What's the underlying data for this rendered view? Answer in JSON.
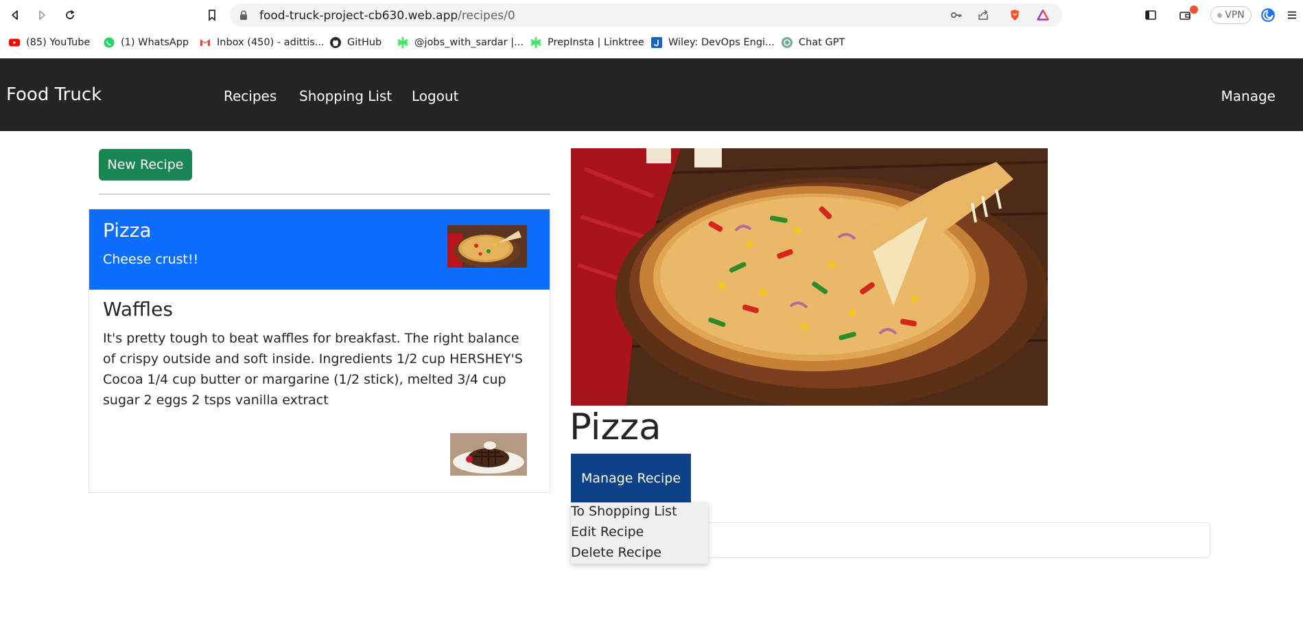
{
  "browser": {
    "url_host": "food-truck-project-cb630.web.app",
    "url_path": "/recipes/0",
    "vpn_label": "VPN",
    "bookmarks": [
      {
        "label": "(85) YouTube",
        "icon": "youtube-icon",
        "color": "#ff0000"
      },
      {
        "label": "(1) WhatsApp",
        "icon": "whatsapp-icon",
        "color": "#25d366"
      },
      {
        "label": "Inbox (450) - adittis...",
        "icon": "gmail-icon",
        "color": "#ea4335"
      },
      {
        "label": "GitHub",
        "icon": "github-icon",
        "color": "#24292e"
      },
      {
        "label": "@jobs_with_sardar |...",
        "icon": "linktree-icon",
        "color": "#43e660"
      },
      {
        "label": "PrepInsta | Linktree",
        "icon": "linktree-icon",
        "color": "#43e660"
      },
      {
        "label": "Wiley: DevOps Engi...",
        "icon": "wiley-j-icon",
        "color": "#1565c0"
      },
      {
        "label": "Chat GPT",
        "icon": "chatgpt-icon",
        "color": "#74aa9c"
      }
    ]
  },
  "navbar": {
    "brand": "Food Truck",
    "links": [
      "Recipes",
      "Shopping List",
      "Logout"
    ],
    "manage": "Manage"
  },
  "recipes": {
    "new_button": "New Recipe",
    "items": [
      {
        "name": "Pizza",
        "description": "Cheese crust!!",
        "active": true
      },
      {
        "name": "Waffles",
        "description": "It's pretty tough to beat waffles for breakfast. The right balance of crispy outside and soft inside. Ingredients 1/2 cup HERSHEY'S Cocoa 1/4 cup butter or margarine (1/2 stick), melted 3/4 cup sugar 2 eggs 2 tsps vanilla extract",
        "active": false
      }
    ]
  },
  "detail": {
    "title": "Pizza",
    "manage_button": "Manage Recipe",
    "dropdown": [
      "To Shopping List",
      "Edit Recipe",
      "Delete Recipe"
    ]
  },
  "colors": {
    "navbar_bg": "#242424",
    "new_button": "#198754",
    "active_item": "#0d6efd",
    "manage_button": "#0d4188"
  }
}
